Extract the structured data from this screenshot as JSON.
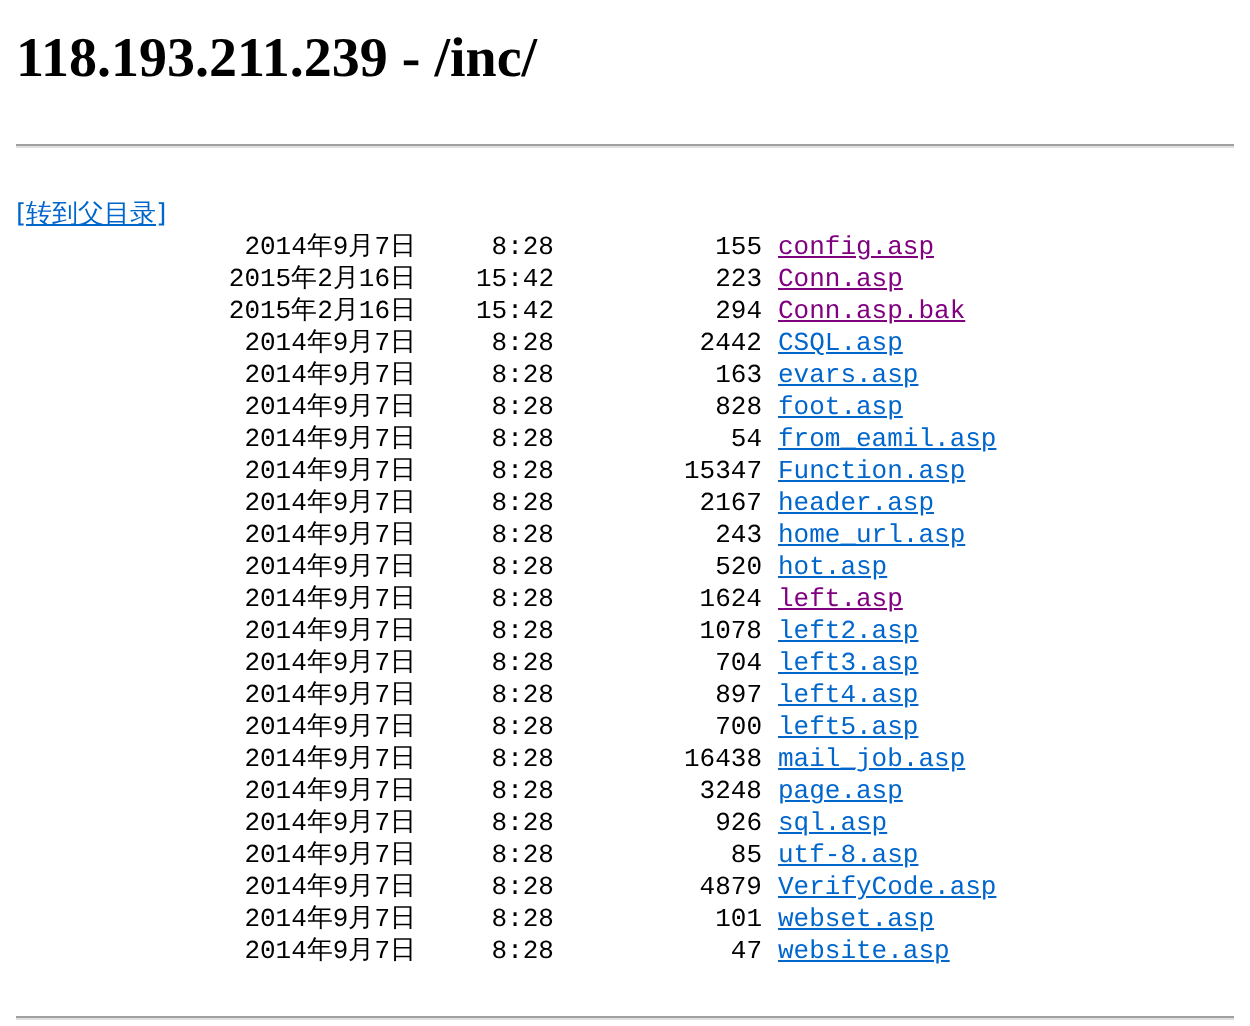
{
  "title": "118.193.211.239 - /inc/",
  "parent_link": "[转到父目录]",
  "files": [
    {
      "date": "2014年9月7日",
      "time": "8:28",
      "size": "155",
      "name": "config.asp",
      "visited": true
    },
    {
      "date": "2015年2月16日",
      "time": "15:42",
      "size": "223",
      "name": "Conn.asp",
      "visited": true
    },
    {
      "date": "2015年2月16日",
      "time": "15:42",
      "size": "294",
      "name": "Conn.asp.bak",
      "visited": true
    },
    {
      "date": "2014年9月7日",
      "time": "8:28",
      "size": "2442",
      "name": "CSQL.asp",
      "visited": false
    },
    {
      "date": "2014年9月7日",
      "time": "8:28",
      "size": "163",
      "name": "evars.asp",
      "visited": false
    },
    {
      "date": "2014年9月7日",
      "time": "8:28",
      "size": "828",
      "name": "foot.asp",
      "visited": false
    },
    {
      "date": "2014年9月7日",
      "time": "8:28",
      "size": "54",
      "name": "from_eamil.asp",
      "visited": false
    },
    {
      "date": "2014年9月7日",
      "time": "8:28",
      "size": "15347",
      "name": "Function.asp",
      "visited": false
    },
    {
      "date": "2014年9月7日",
      "time": "8:28",
      "size": "2167",
      "name": "header.asp",
      "visited": false
    },
    {
      "date": "2014年9月7日",
      "time": "8:28",
      "size": "243",
      "name": "home_url.asp",
      "visited": false
    },
    {
      "date": "2014年9月7日",
      "time": "8:28",
      "size": "520",
      "name": "hot.asp",
      "visited": false
    },
    {
      "date": "2014年9月7日",
      "time": "8:28",
      "size": "1624",
      "name": "left.asp",
      "visited": true
    },
    {
      "date": "2014年9月7日",
      "time": "8:28",
      "size": "1078",
      "name": "left2.asp",
      "visited": false
    },
    {
      "date": "2014年9月7日",
      "time": "8:28",
      "size": "704",
      "name": "left3.asp",
      "visited": false
    },
    {
      "date": "2014年9月7日",
      "time": "8:28",
      "size": "897",
      "name": "left4.asp",
      "visited": false
    },
    {
      "date": "2014年9月7日",
      "time": "8:28",
      "size": "700",
      "name": "left5.asp",
      "visited": false
    },
    {
      "date": "2014年9月7日",
      "time": "8:28",
      "size": "16438",
      "name": "mail_job.asp",
      "visited": false
    },
    {
      "date": "2014年9月7日",
      "time": "8:28",
      "size": "3248",
      "name": "page.asp",
      "visited": false
    },
    {
      "date": "2014年9月7日",
      "time": "8:28",
      "size": "926",
      "name": "sql.asp",
      "visited": false
    },
    {
      "date": "2014年9月7日",
      "time": "8:28",
      "size": "85",
      "name": "utf-8.asp",
      "visited": false
    },
    {
      "date": "2014年9月7日",
      "time": "8:28",
      "size": "4879",
      "name": "VerifyCode.asp",
      "visited": false
    },
    {
      "date": "2014年9月7日",
      "time": "8:28",
      "size": "101",
      "name": "webset.asp",
      "visited": false
    },
    {
      "date": "2014年9月7日",
      "time": "8:28",
      "size": "47",
      "name": "website.asp",
      "visited": false
    }
  ]
}
